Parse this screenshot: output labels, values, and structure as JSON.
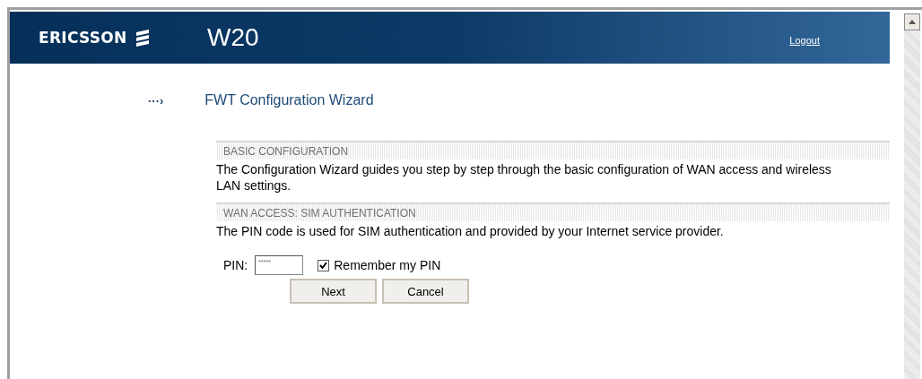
{
  "header": {
    "brand": "ERICSSON",
    "product": "W20",
    "logout": "Logout"
  },
  "wizard": {
    "arrow": "···›",
    "title": "FWT Configuration Wizard"
  },
  "sections": [
    {
      "heading": "BASIC CONFIGURATION",
      "text": "The Configuration Wizard guides you step by step through the basic configuration of WAN access and wireless LAN settings."
    },
    {
      "heading": "WAN ACCESS: SIM AUTHENTICATION",
      "text": "The PIN code is used for SIM authentication and provided by your Internet service provider."
    }
  ],
  "form": {
    "pin_label": "PIN:",
    "pin_value": "*****",
    "remember": {
      "label": "Remember my PIN",
      "checked": true
    },
    "buttons": [
      "Next",
      "Cancel"
    ]
  }
}
